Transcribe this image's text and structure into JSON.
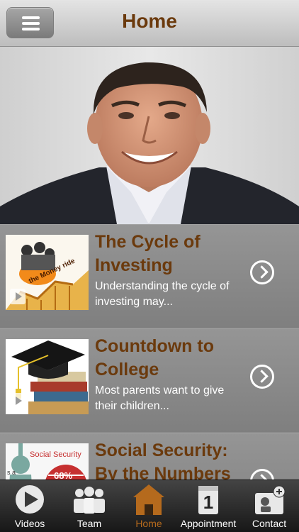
{
  "header": {
    "title": "Home",
    "menu_icon": "hamburger-menu-icon"
  },
  "hero": {
    "image": "advisor-portrait-photo"
  },
  "articles": [
    {
      "title": "The Cycle of Investing",
      "description": "Understanding the cycle of investing may...",
      "thumbnail": "money-ride-rollercoaster-thumbnail",
      "thumbnail_text": "the Money ride"
    },
    {
      "title": "Countdown to College",
      "description": "Most parents want to give their children...",
      "thumbnail": "graduation-cap-books-thumbnail"
    },
    {
      "title": "Social Security: By the Numbers",
      "description": "",
      "thumbnail": "social-security-statue-liberty-thumbnail",
      "thumbnail_text": "Social Security",
      "thumbnail_number": "68%",
      "thumbnail_small_text": "s a"
    }
  ],
  "tabs": [
    {
      "label": "Videos",
      "icon": "play-icon",
      "active": false
    },
    {
      "label": "Team",
      "icon": "team-icon",
      "active": false
    },
    {
      "label": "Home",
      "icon": "home-icon",
      "active": true
    },
    {
      "label": "Appointment",
      "icon": "calendar-icon",
      "active": false,
      "calendar_day": "1"
    },
    {
      "label": "Contact",
      "icon": "contact-card-icon",
      "active": false
    }
  ],
  "colors": {
    "title_brown": "#6b3a0d",
    "active_tab": "#b56a1d",
    "item_bg": "#8a8a8a"
  }
}
